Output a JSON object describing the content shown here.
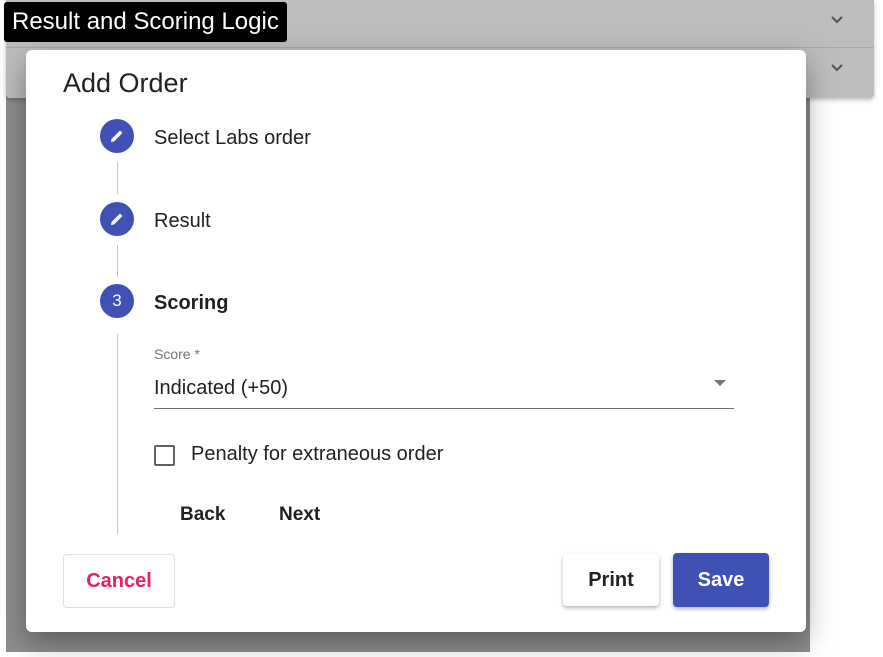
{
  "background": {
    "title": "Result and Scoring Logic"
  },
  "dialog": {
    "title": "Add Order",
    "steps": [
      {
        "label": "Select Labs order",
        "icon": "pencil-icon"
      },
      {
        "label": "Result",
        "icon": "pencil-icon"
      },
      {
        "label": "Scoring",
        "number": "3"
      }
    ],
    "score": {
      "label": "Score *",
      "value": "Indicated (+50)"
    },
    "penalty_checkbox": {
      "label": "Penalty for extraneous order",
      "checked": false
    },
    "step_buttons": {
      "back": "Back",
      "next": "Next"
    },
    "actions": {
      "cancel": "Cancel",
      "print": "Print",
      "save": "Save"
    }
  },
  "colors": {
    "accent": "#3f51b5",
    "cancel": "#e91e63"
  }
}
